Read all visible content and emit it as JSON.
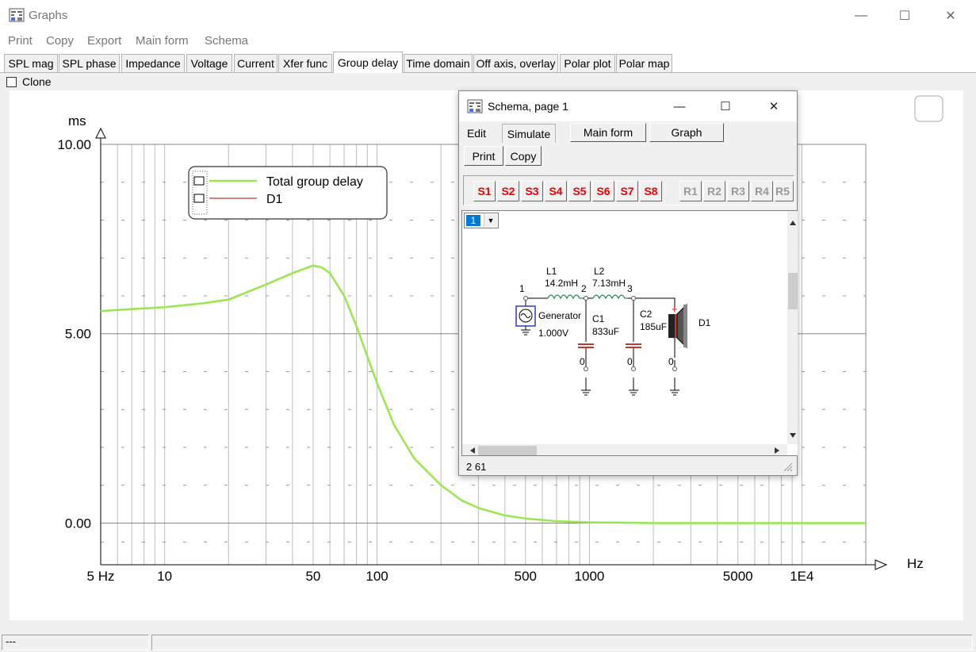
{
  "window": {
    "title": "Graphs",
    "minimize": "—",
    "maximize": "☐",
    "close": "✕"
  },
  "menu": [
    "Print",
    "Copy",
    "Export",
    "Main form",
    "Schema"
  ],
  "tabs": [
    "SPL mag",
    "SPL phase",
    "Impedance",
    "Voltage",
    "Current",
    "Xfer func",
    "Group delay",
    "Time domain",
    "Off axis, overlay",
    "Polar plot",
    "Polar map"
  ],
  "active_tab": "Group delay",
  "clone": {
    "label": "Clone",
    "checked": false
  },
  "status": {
    "left": "---",
    "right": ""
  },
  "colors": {
    "total_group_delay": "#99e64d",
    "d1": "#c0392b",
    "grid": "#bdbdbd",
    "schema_red": "#e00000"
  },
  "chart_data": {
    "type": "line",
    "xscale": "log",
    "xlim": [
      5,
      20000
    ],
    "ylim": [
      -1.1,
      10
    ],
    "ylabel": "ms",
    "xlabel": "Hz",
    "x_ticks": [
      "5 Hz",
      "10",
      "50",
      "100",
      "500",
      "1000",
      "5000",
      "1E4"
    ],
    "y_ticks": [
      "10.00",
      "5.00",
      "0.00"
    ],
    "grid": true,
    "legend": {
      "position": "top-left",
      "entries": [
        "Total group delay",
        "D1"
      ]
    },
    "series": [
      {
        "name": "Total group delay",
        "x": [
          5,
          7,
          10,
          15,
          20,
          30,
          40,
          50,
          55,
          60,
          70,
          80,
          90,
          100,
          120,
          150,
          200,
          250,
          300,
          400,
          500,
          700,
          1000,
          1500,
          2000,
          5000,
          10000,
          20000
        ],
        "y": [
          5.6,
          5.65,
          5.7,
          5.8,
          5.9,
          6.3,
          6.6,
          6.8,
          6.75,
          6.6,
          6.0,
          5.2,
          4.4,
          3.7,
          2.6,
          1.7,
          1.0,
          0.6,
          0.4,
          0.2,
          0.12,
          0.05,
          0.02,
          0.01,
          0.0,
          0.0,
          0.0,
          0.0
        ]
      },
      {
        "name": "D1",
        "x": [],
        "y": []
      }
    ]
  },
  "schema": {
    "title": "Schema, page 1",
    "tabs": [
      "Edit",
      "Simulate"
    ],
    "buttons": {
      "main_form": "Main form",
      "graph": "Graph",
      "print": "Print",
      "copy": "Copy"
    },
    "s_buttons": [
      "S1",
      "S2",
      "S3",
      "S4",
      "S5",
      "S6",
      "S7",
      "S8"
    ],
    "r_buttons": [
      "R1",
      "R2",
      "R3",
      "R4",
      "R5"
    ],
    "page_select": "1",
    "components": {
      "L1_name": "L1",
      "L1_value": "14.2mH",
      "L2_name": "L2",
      "L2_value": "7.13mH",
      "C1_name": "C1",
      "C1_value": "833uF",
      "C2_name": "C2",
      "C2_value": "185uF",
      "gen_name": "Generator",
      "gen_value": "1.000V",
      "driver_name": "D1",
      "node1": "1",
      "node2": "2",
      "node3": "3",
      "node0": "0",
      "plus": "+"
    },
    "status": "2  61"
  }
}
